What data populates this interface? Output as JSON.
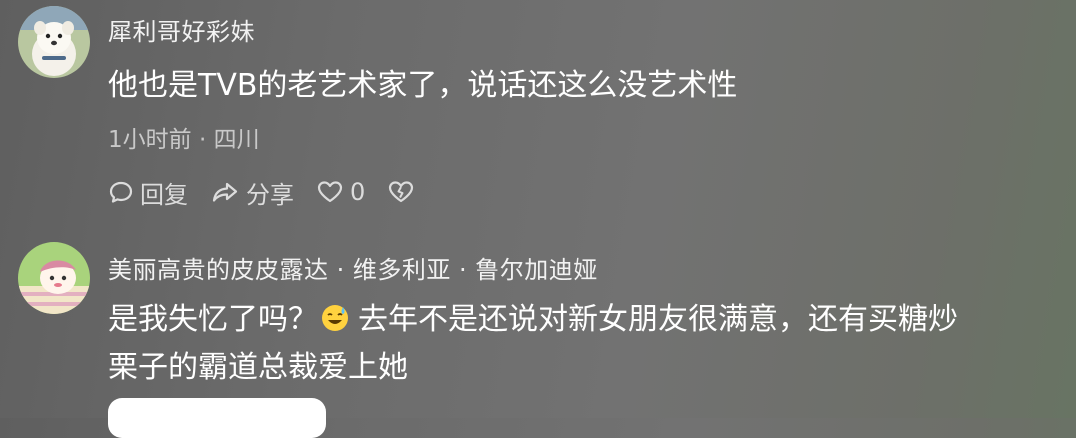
{
  "comments": [
    {
      "username": "犀利哥好彩妹",
      "text": "他也是TVB的老艺术家了，说话还这么没艺术性",
      "meta": "1小时前 · 四川",
      "reply_label": "回复",
      "share_label": "分享",
      "like_count": "0",
      "avatar": "white-dog-avatar"
    },
    {
      "username": "美丽高贵的皮皮露达 · 维多利亚 · 鲁尔加迪娅",
      "text_line1_a": "是我失忆了吗？",
      "emoji": "sweat-smile-emoji",
      "text_line1_b": "去年不是还说对新女朋友很满意，还有买糖炒",
      "text_line2": "栗子的霸道总裁爱上她",
      "avatar": "cartoon-avatar"
    }
  ],
  "colors": {
    "background": "#6b6b6b",
    "text": "#ffffff",
    "meta": "#c9c9c9"
  }
}
